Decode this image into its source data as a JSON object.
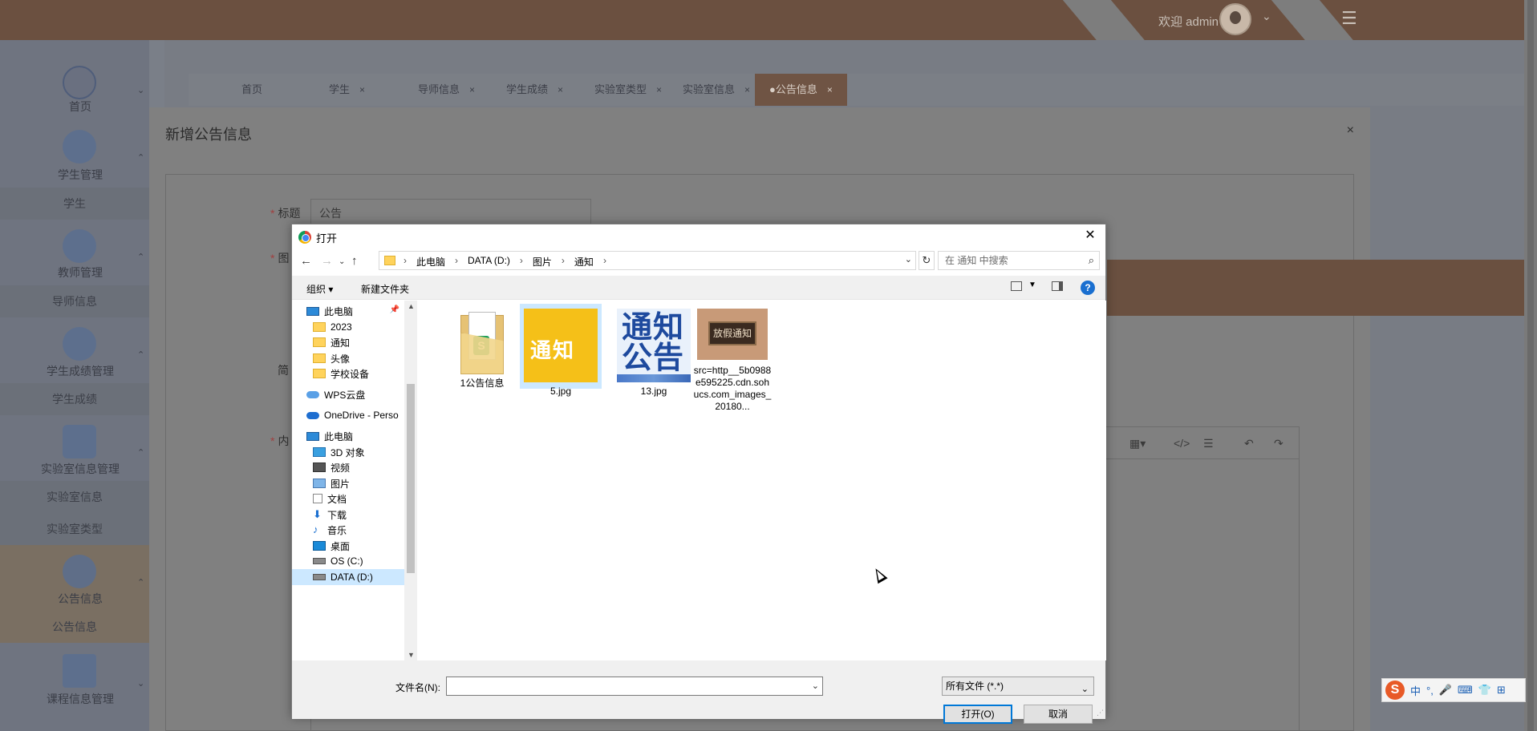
{
  "header": {
    "welcome": "欢迎 admin",
    "chevron": "⌄",
    "menu_icon": "☰"
  },
  "sidebar": {
    "groups": [
      {
        "label": "首页",
        "icon": "home-icon"
      },
      {
        "label": "学生管理",
        "icon": "user-icon",
        "sub": [
          "学生"
        ]
      },
      {
        "label": "教师管理",
        "icon": "grid-icon",
        "sub": [
          "导师信息"
        ]
      },
      {
        "label": "学生成绩管理",
        "icon": "glasses-icon",
        "sub": [
          "学生成绩"
        ]
      },
      {
        "label": "实验室信息管理",
        "icon": "lab-icon",
        "sub": [
          "实验室信息",
          "实验室类型"
        ]
      },
      {
        "label": "公告信息",
        "icon": "mail-icon",
        "sub": [
          "公告信息"
        ]
      },
      {
        "label": "课程信息管理",
        "icon": "apps-icon",
        "sub": []
      }
    ]
  },
  "tabs": [
    {
      "label": "首页",
      "closable": false
    },
    {
      "label": "学生",
      "closable": true
    },
    {
      "label": "导师信息",
      "closable": true
    },
    {
      "label": "学生成绩",
      "closable": true
    },
    {
      "label": "实验室类型",
      "closable": true
    },
    {
      "label": "实验室信息",
      "closable": true
    },
    {
      "label": "●公告信息",
      "closable": true,
      "active": true
    }
  ],
  "modal": {
    "title": "新增公告信息",
    "close": "×",
    "fields": {
      "title_label": "标题",
      "title_value": "公告",
      "image_label": "图",
      "intro_label": "简",
      "content_label": "内"
    }
  },
  "dialog": {
    "title": "打开",
    "close": "✕",
    "path": [
      "此电脑",
      "DATA (D:)",
      "图片",
      "通知"
    ],
    "search_placeholder": "在 通知 中搜索",
    "organize": "组织 ▾",
    "new_folder": "新建文件夹",
    "help": "?",
    "nav_items": [
      {
        "label": "此电脑",
        "icon": "pc",
        "indent": 1,
        "pin": true
      },
      {
        "label": "2023",
        "icon": "folder",
        "indent": 2
      },
      {
        "label": "通知",
        "icon": "folder",
        "indent": 2
      },
      {
        "label": "头像",
        "icon": "folder",
        "indent": 2
      },
      {
        "label": "学校设备",
        "icon": "folder",
        "indent": 2
      },
      {
        "label": "WPS云盘",
        "icon": "cloud",
        "indent": 1
      },
      {
        "label": "OneDrive - Perso",
        "icon": "cloud2",
        "indent": 1
      },
      {
        "label": "此电脑",
        "icon": "pc",
        "indent": 1
      },
      {
        "label": "3D 对象",
        "icon": "cube",
        "indent": 2
      },
      {
        "label": "视频",
        "icon": "video",
        "indent": 2
      },
      {
        "label": "图片",
        "icon": "pic",
        "indent": 2
      },
      {
        "label": "文档",
        "icon": "doc",
        "indent": 2
      },
      {
        "label": "下载",
        "icon": "down",
        "indent": 2
      },
      {
        "label": "音乐",
        "icon": "music",
        "indent": 2
      },
      {
        "label": "桌面",
        "icon": "desk",
        "indent": 2
      },
      {
        "label": "OS (C:)",
        "icon": "drive",
        "indent": 2
      },
      {
        "label": "DATA (D:)",
        "icon": "drive",
        "indent": 2,
        "selected": true
      }
    ],
    "files": [
      {
        "name": "1公告信息",
        "kind": "folder"
      },
      {
        "name": "5.jpg",
        "kind": "yellow",
        "text": "通知",
        "selected": true
      },
      {
        "name": "13.jpg",
        "kind": "blue",
        "text1": "通知",
        "text2": "公告"
      },
      {
        "name": "src=http__5b0988e595225.cdn.sohucs.com_images_20180...",
        "kind": "board",
        "text": "放假通知"
      }
    ],
    "filename_label": "文件名(N):",
    "filename_value": "",
    "filetype": "所有文件 (*.*)",
    "open": "打开(O)",
    "cancel": "取消"
  },
  "ime": {
    "chars": [
      "中",
      "°,",
      "🎤",
      "⌨",
      "👕",
      "⊞"
    ]
  }
}
